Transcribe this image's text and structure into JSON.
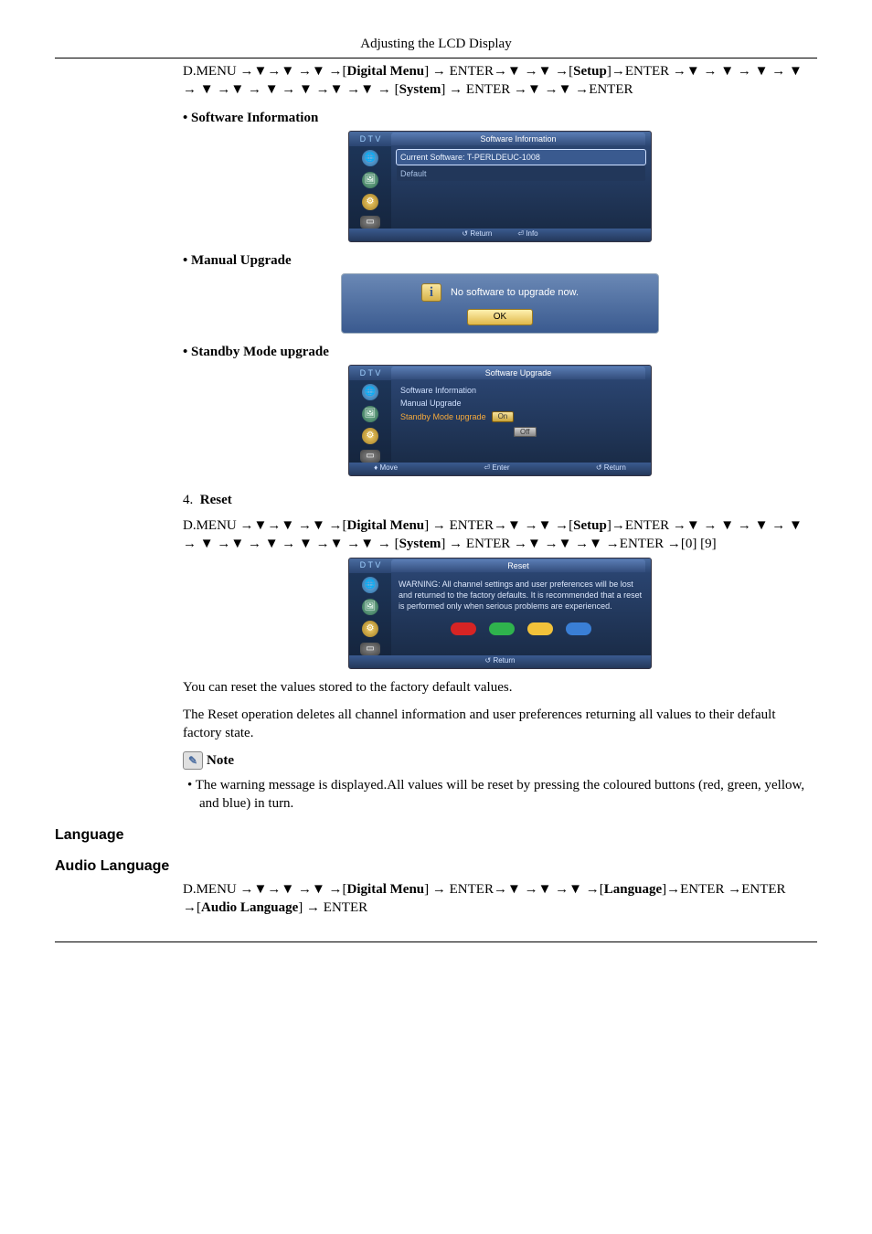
{
  "header": {
    "title": "Adjusting the LCD Display"
  },
  "nav1": {
    "prefix": "D.MENU ",
    "digital": "Digital Menu",
    "enter": "ENTER",
    "setup": "Setup",
    "system": "System"
  },
  "sw_info_label": "Software Information",
  "panel_sw": {
    "dtv": "D T V",
    "title": "Software Information",
    "row1": "Current Software: T-PERLDEUC-1008",
    "row2": "Default",
    "foot_return": "Return",
    "foot_return_ic": "↺",
    "foot_info": "Info",
    "foot_info_ic": "⏎"
  },
  "manual_upgrade_label": "Manual Upgrade",
  "dialog_upg": {
    "msg": "No software to upgrade now.",
    "ok": "OK"
  },
  "standby_label": "Standby Mode upgrade",
  "panel_su": {
    "dtv": "D T V",
    "title": "Software Upgrade",
    "r1": "Software Information",
    "r2": "Manual Upgrade",
    "r3": "Standby Mode upgrade",
    "on": "On",
    "off": "Off",
    "f_move": "Move",
    "f_move_ic": "♦",
    "f_enter": "Enter",
    "f_enter_ic": "⏎",
    "f_return": "Return",
    "f_return_ic": "↺"
  },
  "reset_num": "4.",
  "reset_label": "Reset",
  "nav2_tail": "[0]  [9]",
  "panel_reset": {
    "dtv": "D T V",
    "title": "Reset",
    "warn": "WARNING: All channel settings and user preferences will be lost and returned to the factory defaults. It is recommended that a reset is performed only when serious problems are experienced.",
    "foot": "Return",
    "foot_ic": "↺"
  },
  "para1": "You can reset the values stored to the factory default values.",
  "para2": "The Reset operation deletes all channel information and user preferences returning all values to their default factory state.",
  "note_label": "Note",
  "note_text": "The warning message is displayed.All values will be reset by pressing the coloured buttons (red, green, yellow, and blue) in turn.",
  "h_language": "Language",
  "h_audio_language": "Audio Language",
  "nav3": {
    "lang": "Language",
    "audio_lang": "Audio Language"
  }
}
